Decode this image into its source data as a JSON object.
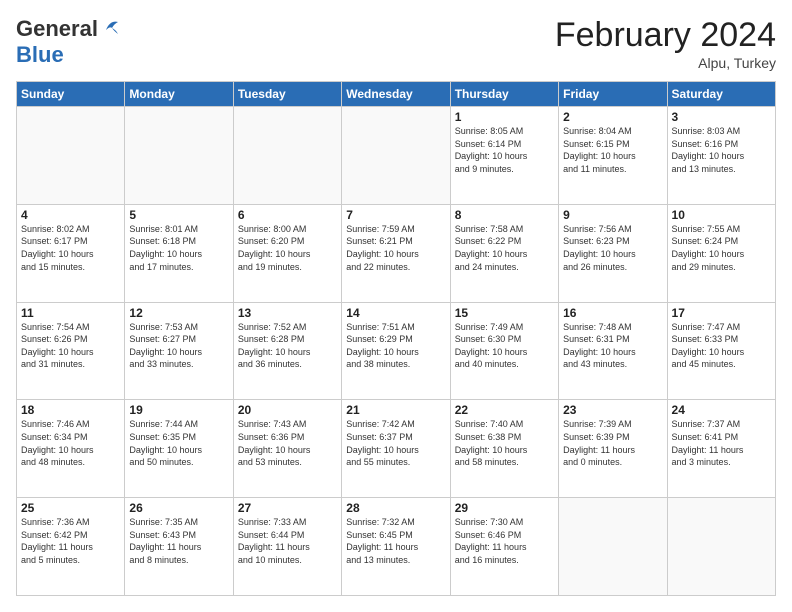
{
  "logo": {
    "line1": "General",
    "line2": "Blue",
    "bird_color": "#2a6db5"
  },
  "header": {
    "title": "February 2024",
    "subtitle": "Alpu, Turkey"
  },
  "days_of_week": [
    "Sunday",
    "Monday",
    "Tuesday",
    "Wednesday",
    "Thursday",
    "Friday",
    "Saturday"
  ],
  "weeks": [
    [
      {
        "day": "",
        "info": ""
      },
      {
        "day": "",
        "info": ""
      },
      {
        "day": "",
        "info": ""
      },
      {
        "day": "",
        "info": ""
      },
      {
        "day": "1",
        "info": "Sunrise: 8:05 AM\nSunset: 6:14 PM\nDaylight: 10 hours\nand 9 minutes."
      },
      {
        "day": "2",
        "info": "Sunrise: 8:04 AM\nSunset: 6:15 PM\nDaylight: 10 hours\nand 11 minutes."
      },
      {
        "day": "3",
        "info": "Sunrise: 8:03 AM\nSunset: 6:16 PM\nDaylight: 10 hours\nand 13 minutes."
      }
    ],
    [
      {
        "day": "4",
        "info": "Sunrise: 8:02 AM\nSunset: 6:17 PM\nDaylight: 10 hours\nand 15 minutes."
      },
      {
        "day": "5",
        "info": "Sunrise: 8:01 AM\nSunset: 6:18 PM\nDaylight: 10 hours\nand 17 minutes."
      },
      {
        "day": "6",
        "info": "Sunrise: 8:00 AM\nSunset: 6:20 PM\nDaylight: 10 hours\nand 19 minutes."
      },
      {
        "day": "7",
        "info": "Sunrise: 7:59 AM\nSunset: 6:21 PM\nDaylight: 10 hours\nand 22 minutes."
      },
      {
        "day": "8",
        "info": "Sunrise: 7:58 AM\nSunset: 6:22 PM\nDaylight: 10 hours\nand 24 minutes."
      },
      {
        "day": "9",
        "info": "Sunrise: 7:56 AM\nSunset: 6:23 PM\nDaylight: 10 hours\nand 26 minutes."
      },
      {
        "day": "10",
        "info": "Sunrise: 7:55 AM\nSunset: 6:24 PM\nDaylight: 10 hours\nand 29 minutes."
      }
    ],
    [
      {
        "day": "11",
        "info": "Sunrise: 7:54 AM\nSunset: 6:26 PM\nDaylight: 10 hours\nand 31 minutes."
      },
      {
        "day": "12",
        "info": "Sunrise: 7:53 AM\nSunset: 6:27 PM\nDaylight: 10 hours\nand 33 minutes."
      },
      {
        "day": "13",
        "info": "Sunrise: 7:52 AM\nSunset: 6:28 PM\nDaylight: 10 hours\nand 36 minutes."
      },
      {
        "day": "14",
        "info": "Sunrise: 7:51 AM\nSunset: 6:29 PM\nDaylight: 10 hours\nand 38 minutes."
      },
      {
        "day": "15",
        "info": "Sunrise: 7:49 AM\nSunset: 6:30 PM\nDaylight: 10 hours\nand 40 minutes."
      },
      {
        "day": "16",
        "info": "Sunrise: 7:48 AM\nSunset: 6:31 PM\nDaylight: 10 hours\nand 43 minutes."
      },
      {
        "day": "17",
        "info": "Sunrise: 7:47 AM\nSunset: 6:33 PM\nDaylight: 10 hours\nand 45 minutes."
      }
    ],
    [
      {
        "day": "18",
        "info": "Sunrise: 7:46 AM\nSunset: 6:34 PM\nDaylight: 10 hours\nand 48 minutes."
      },
      {
        "day": "19",
        "info": "Sunrise: 7:44 AM\nSunset: 6:35 PM\nDaylight: 10 hours\nand 50 minutes."
      },
      {
        "day": "20",
        "info": "Sunrise: 7:43 AM\nSunset: 6:36 PM\nDaylight: 10 hours\nand 53 minutes."
      },
      {
        "day": "21",
        "info": "Sunrise: 7:42 AM\nSunset: 6:37 PM\nDaylight: 10 hours\nand 55 minutes."
      },
      {
        "day": "22",
        "info": "Sunrise: 7:40 AM\nSunset: 6:38 PM\nDaylight: 10 hours\nand 58 minutes."
      },
      {
        "day": "23",
        "info": "Sunrise: 7:39 AM\nSunset: 6:39 PM\nDaylight: 11 hours\nand 0 minutes."
      },
      {
        "day": "24",
        "info": "Sunrise: 7:37 AM\nSunset: 6:41 PM\nDaylight: 11 hours\nand 3 minutes."
      }
    ],
    [
      {
        "day": "25",
        "info": "Sunrise: 7:36 AM\nSunset: 6:42 PM\nDaylight: 11 hours\nand 5 minutes."
      },
      {
        "day": "26",
        "info": "Sunrise: 7:35 AM\nSunset: 6:43 PM\nDaylight: 11 hours\nand 8 minutes."
      },
      {
        "day": "27",
        "info": "Sunrise: 7:33 AM\nSunset: 6:44 PM\nDaylight: 11 hours\nand 10 minutes."
      },
      {
        "day": "28",
        "info": "Sunrise: 7:32 AM\nSunset: 6:45 PM\nDaylight: 11 hours\nand 13 minutes."
      },
      {
        "day": "29",
        "info": "Sunrise: 7:30 AM\nSunset: 6:46 PM\nDaylight: 11 hours\nand 16 minutes."
      },
      {
        "day": "",
        "info": ""
      },
      {
        "day": "",
        "info": ""
      }
    ]
  ]
}
